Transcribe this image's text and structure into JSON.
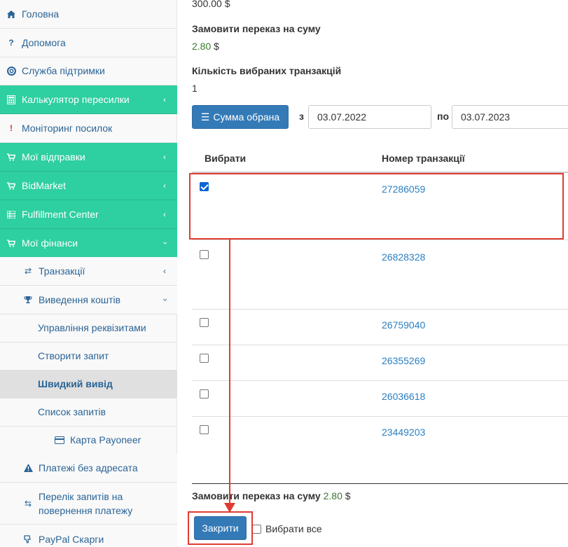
{
  "sidebar": {
    "items": [
      {
        "label": "Головна",
        "icon": "home-icon"
      },
      {
        "label": "Допомога",
        "icon": "question-icon"
      },
      {
        "label": "Служба підтримки",
        "icon": "lifebuoy-icon"
      },
      {
        "label": "Калькулятор пересилки",
        "icon": "calculator-icon"
      },
      {
        "label": "Моніторинг посилок",
        "icon": "exclamation-icon"
      },
      {
        "label": "Мої відправки",
        "icon": "cart-icon"
      },
      {
        "label": "BidMarket",
        "icon": "cart-icon"
      },
      {
        "label": "Fulfillment Center",
        "icon": "list-icon"
      },
      {
        "label": "Мої фінанси",
        "icon": "cart-icon"
      },
      {
        "label": "Транзакції",
        "icon": "exchange-icon"
      },
      {
        "label": "Виведення коштів",
        "icon": "trophy-icon"
      },
      {
        "label": "Управління реквізитами"
      },
      {
        "label": "Створити запит"
      },
      {
        "label": "Швидкий вивід"
      },
      {
        "label": "Список запитів"
      },
      {
        "label": "Карта Payoneer",
        "icon": "credit-card-icon"
      },
      {
        "label": "Платежі без адресата",
        "icon": "warning-icon"
      },
      {
        "label": "Перелік запитів на",
        "label2": "повернення платежу",
        "icon": "retweet-icon"
      },
      {
        "label": "PayPal Скарги",
        "icon": "thumbs-down-icon"
      }
    ]
  },
  "main": {
    "top_amount": "300.00 $",
    "order_label": "Замовити переказ на суму",
    "order_value": "2.80",
    "order_currency": "$",
    "count_label": "Кількість вибраних транзакцій",
    "count_value": "1",
    "sum_button": "Сумма обрана",
    "from_label": "з",
    "from_date": "03.07.2022",
    "to_label": "по",
    "to_date": "03.07.2023",
    "col_select": "Вибрати",
    "col_txn": "Номер транзакції",
    "rows": [
      {
        "id": "27286059",
        "checked": true
      },
      {
        "id": "26828328",
        "checked": false
      },
      {
        "id": "26759040",
        "checked": false
      },
      {
        "id": "26355269",
        "checked": false
      },
      {
        "id": "26036618",
        "checked": false
      },
      {
        "id": "23449203",
        "checked": false
      }
    ],
    "footer_label": "Замовити переказ на суму",
    "footer_value": "2.80",
    "footer_currency": "$",
    "close_button": "Закрити",
    "select_all": "Вибрати все"
  },
  "colors": {
    "accent": "#2ecfa0",
    "primary": "#337ab7",
    "annotation": "#e03b32",
    "link": "#2a7fc1"
  }
}
